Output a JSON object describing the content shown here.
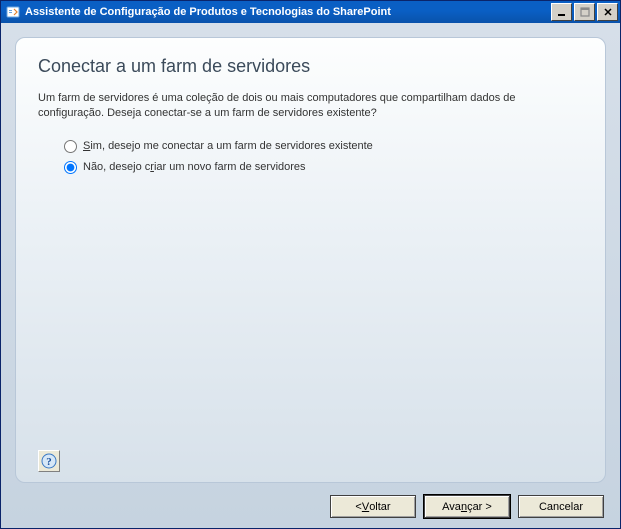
{
  "window": {
    "title": "Assistente de Configuração de Produtos e Tecnologias do SharePoint"
  },
  "page": {
    "heading": "Conectar a um farm de servidores",
    "description": "Um farm de servidores é uma coleção de dois ou mais computadores que compartilham dados de configuração. Deseja conectar-se a um farm de servidores existente?"
  },
  "options": {
    "connect_existing": {
      "prefix": "",
      "hotkey": "S",
      "rest": "im, desejo me conectar a um farm de servidores existente",
      "selected": false
    },
    "create_new": {
      "prefix": "Não, desejo c",
      "hotkey": "r",
      "rest": "iar um novo farm de servidores",
      "selected": true
    }
  },
  "buttons": {
    "back": {
      "prefix": "< ",
      "hotkey": "V",
      "rest": "oltar"
    },
    "next": {
      "prefix": "Ava",
      "hotkey": "n",
      "rest": "çar  >"
    },
    "cancel": {
      "label": "Cancelar"
    }
  },
  "icons": {
    "app": "sharepoint-config-icon",
    "help": "help-icon"
  }
}
